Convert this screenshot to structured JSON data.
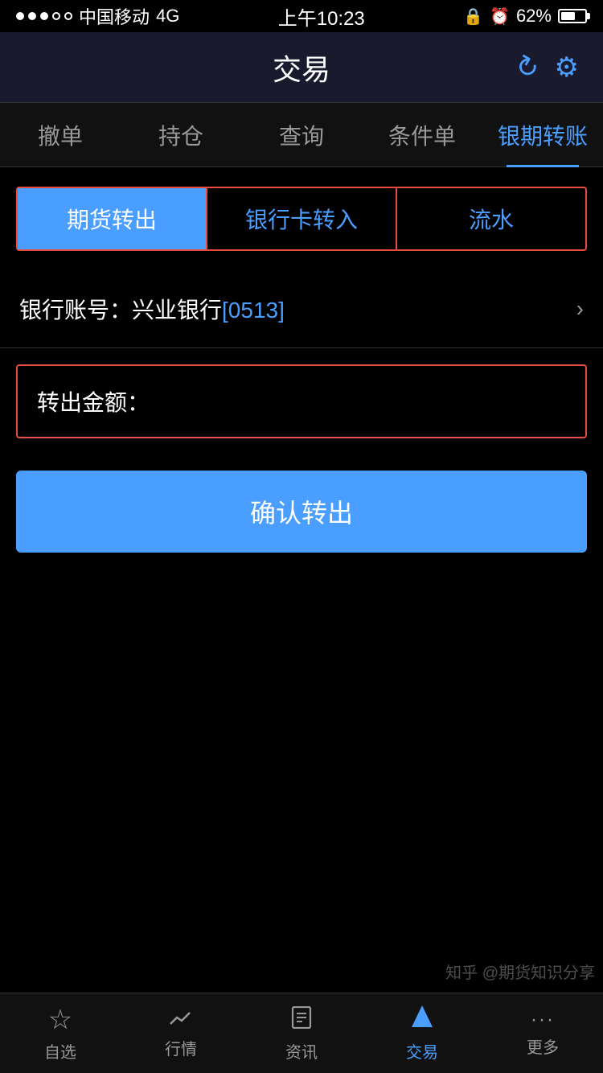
{
  "status_bar": {
    "carrier": "中国移动",
    "network": "4G",
    "time": "上午10:23",
    "battery": "62%"
  },
  "header": {
    "title": "交易",
    "refresh_icon": "↻",
    "settings_icon": "⚙"
  },
  "nav_tabs": [
    {
      "label": "撤单",
      "active": false
    },
    {
      "label": "持仓",
      "active": false
    },
    {
      "label": "查询",
      "active": false
    },
    {
      "label": "条件单",
      "active": false
    },
    {
      "label": "银期转账",
      "active": true
    }
  ],
  "sub_tabs": [
    {
      "label": "期货转出",
      "active": true
    },
    {
      "label": "银行卡转入",
      "active": false
    },
    {
      "label": "流水",
      "active": false
    }
  ],
  "bank_account": {
    "label_prefix": "银行账号：兴业银行",
    "label_highlight": "[0513]"
  },
  "amount_field": {
    "label": "转出金额："
  },
  "confirm_button": {
    "label": "确认转出"
  },
  "bottom_nav": [
    {
      "label": "自选",
      "icon": "☆",
      "active": false
    },
    {
      "label": "行情",
      "icon": "📈",
      "active": false
    },
    {
      "label": "资讯",
      "icon": "📄",
      "active": false
    },
    {
      "label": "交易",
      "icon": "⚡",
      "active": true
    },
    {
      "label": "更多",
      "icon": "···",
      "active": false
    }
  ],
  "watermark": {
    "line1": "知乎 @期货知识分享",
    "line2": ""
  }
}
